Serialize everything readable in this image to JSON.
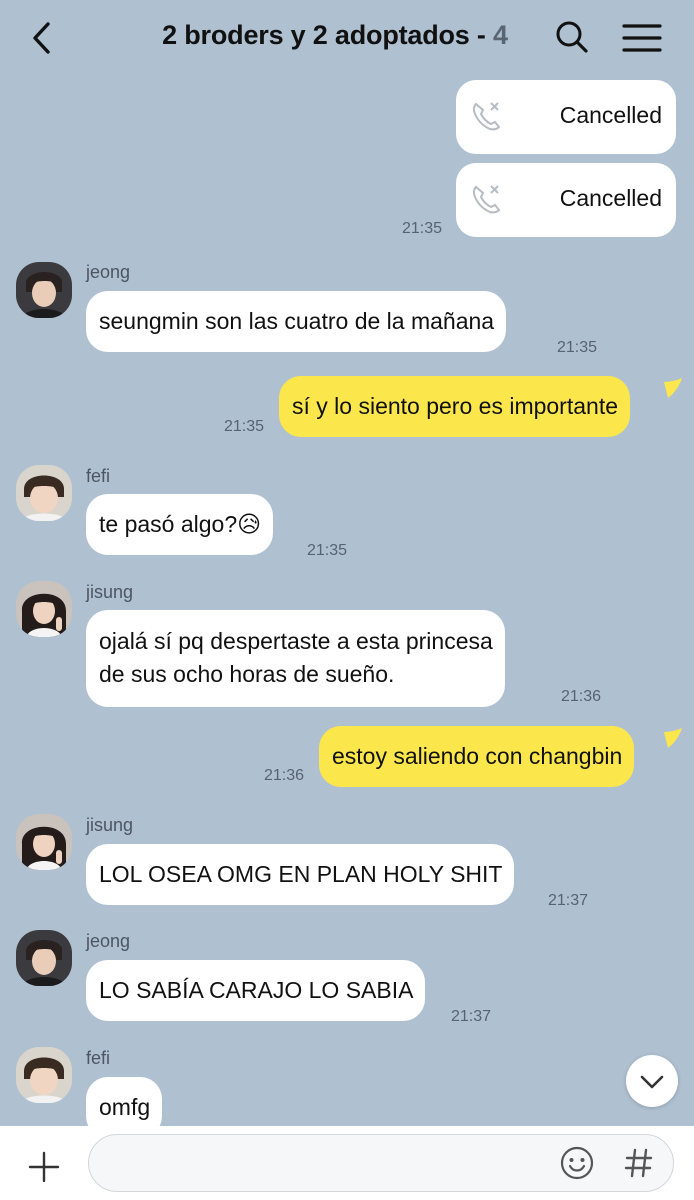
{
  "header": {
    "title": "2 broders y 2 adoptados - ",
    "member_count": "4"
  },
  "messages": {
    "call1": {
      "label": "Cancelled"
    },
    "call2": {
      "label": "Cancelled",
      "time": "21:35"
    },
    "m1": {
      "sender": "jeong",
      "text": "seungmin son las cuatro de la mañana",
      "time": "21:35"
    },
    "m2": {
      "text": "sí y lo siento pero es importante",
      "time": "21:35"
    },
    "m3": {
      "sender": "fefi",
      "text": "te pasó algo?😥",
      "time": "21:35"
    },
    "m4": {
      "sender": "jisung",
      "line1": "ojalá sí pq despertaste a esta princesa",
      "line2": "de sus ocho horas de sueño.",
      "time": "21:36"
    },
    "m5": {
      "text": "estoy saliendo con changbin",
      "time": "21:36"
    },
    "m6": {
      "sender": "jisung",
      "text": "LOL OSEA OMG EN PLAN HOLY SHIT",
      "time": "21:37"
    },
    "m7": {
      "sender": "jeong",
      "text": "LO SABÍA CARAJO LO SABIA",
      "time": "21:37"
    },
    "m8": {
      "sender": "fefi",
      "text": "omfg"
    }
  },
  "composer": {
    "placeholder": ""
  },
  "colors": {
    "background": "#afc0d1",
    "my_bubble": "#fbe74c",
    "their_bubble": "#ffffff"
  }
}
